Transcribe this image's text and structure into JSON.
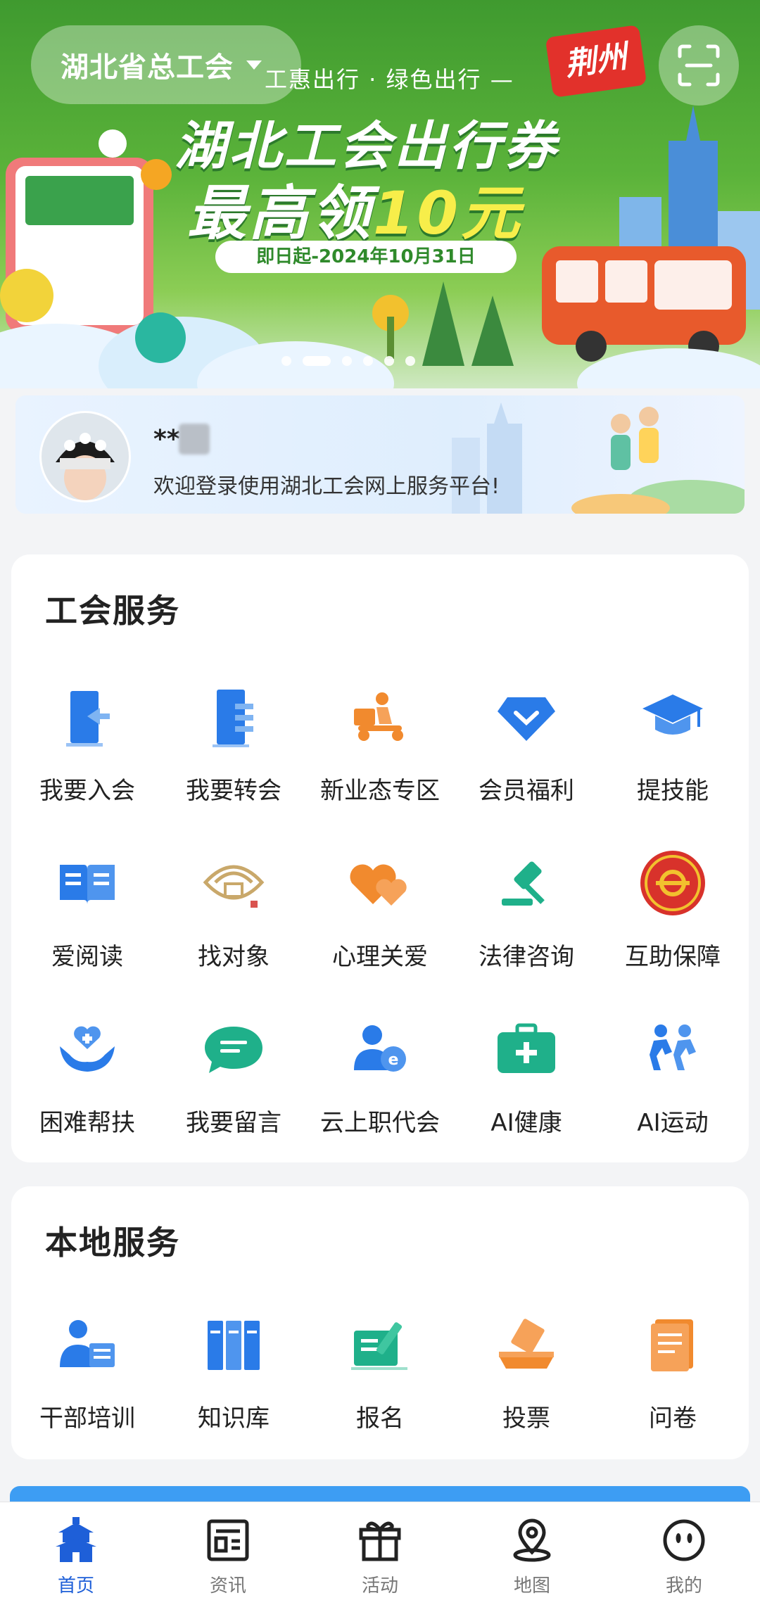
{
  "banner": {
    "region": "湖北省总工会",
    "subtitle": "工惠出行 · 绿色出行 —",
    "title_line1": "湖北工会出行券",
    "title_line2_a": "最高领",
    "title_line2_b": "10元",
    "date_range": "即日起-2024年10月31日",
    "city_tag": "荆州"
  },
  "user": {
    "name": "**",
    "welcome": "欢迎登录使用湖北工会网上服务平台!"
  },
  "union_services": {
    "title": "工会服务",
    "items": [
      {
        "label": "我要入会",
        "icon": "door-enter-icon"
      },
      {
        "label": "我要转会",
        "icon": "door-transfer-icon"
      },
      {
        "label": "新业态专区",
        "icon": "delivery-scooter-icon"
      },
      {
        "label": "会员福利",
        "icon": "diamond-icon"
      },
      {
        "label": "提技能",
        "icon": "graduation-cap-icon"
      },
      {
        "label": "爱阅读",
        "icon": "book-icon"
      },
      {
        "label": "找对象",
        "icon": "matchmaking-icon"
      },
      {
        "label": "心理关爱",
        "icon": "hearts-icon"
      },
      {
        "label": "法律咨询",
        "icon": "gavel-icon"
      },
      {
        "label": "互助保障",
        "icon": "union-emblem-icon"
      },
      {
        "label": "困难帮扶",
        "icon": "hands-heart-icon"
      },
      {
        "label": "我要留言",
        "icon": "chat-bubble-icon"
      },
      {
        "label": "云上职代会",
        "icon": "e-meeting-icon"
      },
      {
        "label": "AI健康",
        "icon": "medical-kit-icon"
      },
      {
        "label": "AI运动",
        "icon": "running-people-icon"
      }
    ]
  },
  "local_services": {
    "title": "本地服务",
    "items": [
      {
        "label": "干部培训",
        "icon": "trainer-icon"
      },
      {
        "label": "知识库",
        "icon": "bookshelf-icon"
      },
      {
        "label": "报名",
        "icon": "signup-pen-icon"
      },
      {
        "label": "投票",
        "icon": "ballot-box-icon"
      },
      {
        "label": "问卷",
        "icon": "questionnaire-icon"
      }
    ]
  },
  "nav": {
    "items": [
      {
        "label": "首页",
        "icon": "home-tower-icon"
      },
      {
        "label": "资讯",
        "icon": "news-icon"
      },
      {
        "label": "活动",
        "icon": "gift-icon"
      },
      {
        "label": "地图",
        "icon": "map-pin-icon"
      },
      {
        "label": "我的",
        "icon": "profile-face-icon"
      }
    ]
  },
  "colors": {
    "accent_blue": "#1e6fe0",
    "orange": "#f18a2e",
    "green": "#1fb08a",
    "red": "#e2312b",
    "banner_green": "#4ea634"
  }
}
